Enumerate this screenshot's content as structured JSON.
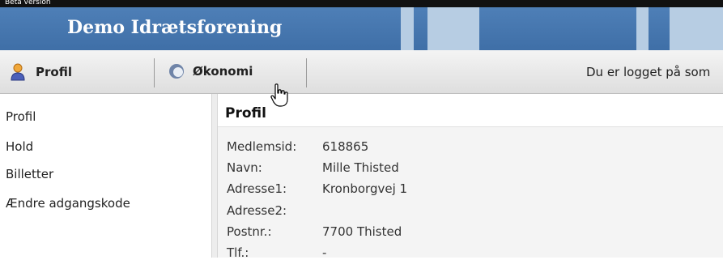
{
  "beta_label": "Beta version",
  "app_title": "Demo Idrætsforening",
  "colors": {
    "title_bar": "#4672aa",
    "deco_blocks": "#b7cde3",
    "panel_bg": "#f4f4f4"
  },
  "nav": {
    "profil": {
      "label": "Profil",
      "icon": "person-icon"
    },
    "okonomi": {
      "label": "Økonomi",
      "icon": "coin-icon"
    },
    "login_status": "Du er logget på som"
  },
  "sidebar": {
    "items": [
      {
        "label": "Profil"
      },
      {
        "label": "Hold"
      },
      {
        "label": "Billetter"
      },
      {
        "label": "Ændre adgangskode"
      }
    ]
  },
  "main": {
    "title": "Profil",
    "fields": [
      {
        "label": "Medlemsid:",
        "value": "618865"
      },
      {
        "label": "Navn:",
        "value": "Mille Thisted"
      },
      {
        "label": "Adresse1:",
        "value": "Kronborgvej 1"
      },
      {
        "label": "Adresse2:",
        "value": ""
      },
      {
        "label": "Postnr.:",
        "value": "7700 Thisted"
      },
      {
        "label": "Tlf.:",
        "value": "-"
      }
    ]
  }
}
